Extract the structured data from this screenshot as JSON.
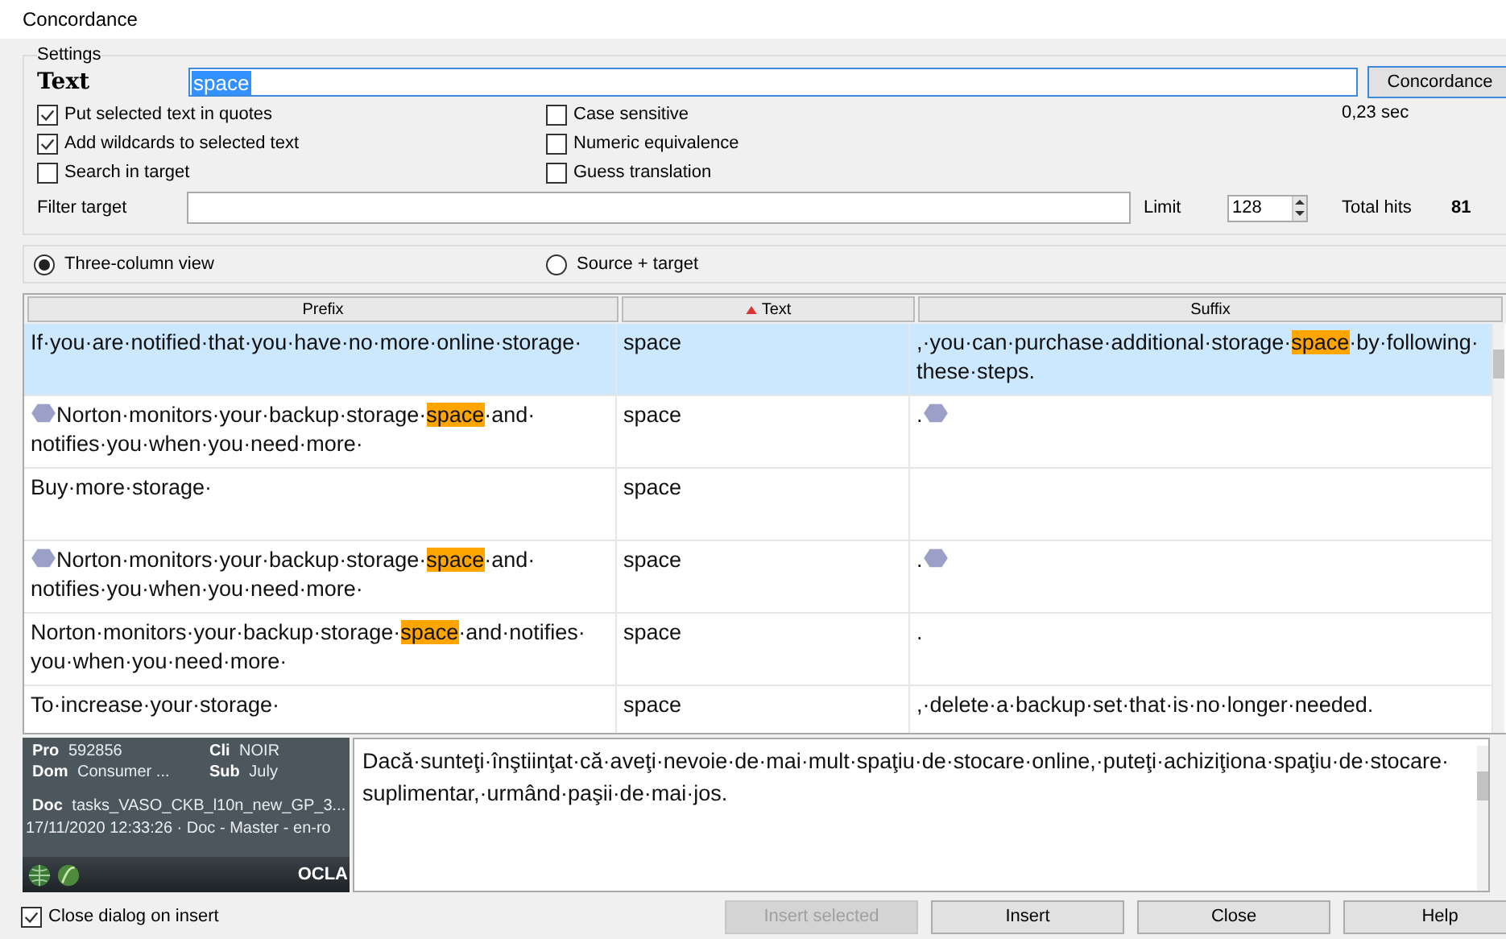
{
  "window": {
    "title": "Concordance"
  },
  "settings": {
    "legend": "Settings",
    "text_label": "Text",
    "text_value": "space",
    "concordance_button": "Concordance",
    "elapsed": "0,23 sec",
    "options": [
      {
        "label": "Put selected text in quotes",
        "checked": true
      },
      {
        "label": "Add wildcards to selected text",
        "checked": true
      },
      {
        "label": "Search in target",
        "checked": false
      },
      {
        "label": "Case sensitive",
        "checked": false
      },
      {
        "label": "Numeric equivalence",
        "checked": false
      },
      {
        "label": "Guess translation",
        "checked": false
      }
    ],
    "filter_label": "Filter target",
    "limit_label": "Limit",
    "limit_value": "128",
    "total_label": "Total hits",
    "total_value": "81"
  },
  "view_options": [
    {
      "label": "Three-column view",
      "selected": true
    },
    {
      "label": "Source + target",
      "selected": false
    }
  ],
  "table": {
    "columns": [
      {
        "label": "Prefix",
        "sorted": false
      },
      {
        "label": "Text",
        "sorted": true
      },
      {
        "label": "Suffix",
        "sorted": false
      }
    ],
    "rows": [
      {
        "selected": true,
        "prefix": [
          {
            "kind": "text",
            "text": "If·you·are·notified·that·you·have·no·more·online·storage·"
          }
        ],
        "text": "space",
        "suffix": [
          {
            "kind": "text",
            "text": ",·you·can·purchase·additional·storage·"
          },
          {
            "kind": "match",
            "text": "space"
          },
          {
            "kind": "text",
            "text": "·by·following·these·steps."
          }
        ]
      },
      {
        "selected": false,
        "prefix": [
          {
            "kind": "tag"
          },
          {
            "kind": "text",
            "text": "Norton·monitors·your·backup·storage·"
          },
          {
            "kind": "match",
            "text": "space"
          },
          {
            "kind": "text",
            "text": "·and·notifies·you·when·you·need·more·"
          }
        ],
        "text": "space",
        "suffix": [
          {
            "kind": "text",
            "text": "."
          },
          {
            "kind": "tag"
          }
        ]
      },
      {
        "selected": false,
        "prefix": [
          {
            "kind": "text",
            "text": "Buy·more·storage·"
          }
        ],
        "text": "space",
        "suffix": []
      },
      {
        "selected": false,
        "prefix": [
          {
            "kind": "tag"
          },
          {
            "kind": "text",
            "text": "Norton·monitors·your·backup·storage·"
          },
          {
            "kind": "match",
            "text": "space"
          },
          {
            "kind": "text",
            "text": "·and·notifies·you·when·you·need·more·"
          }
        ],
        "text": "space",
        "suffix": [
          {
            "kind": "text",
            "text": "."
          },
          {
            "kind": "tag"
          }
        ]
      },
      {
        "selected": false,
        "prefix": [
          {
            "kind": "text",
            "text": "Norton·monitors·your·backup·storage·"
          },
          {
            "kind": "match",
            "text": "space"
          },
          {
            "kind": "text",
            "text": "·and·notifies·you·when·you·need·more·"
          }
        ],
        "text": "space",
        "suffix": [
          {
            "kind": "text",
            "text": "."
          }
        ]
      },
      {
        "selected": false,
        "prefix": [
          {
            "kind": "text",
            "text": "To·increase·your·storage·"
          }
        ],
        "text": "space",
        "suffix": [
          {
            "kind": "text",
            "text": ",·delete·a·backup·set·that·is·no·longer·needed."
          }
        ]
      }
    ]
  },
  "info": {
    "fields": [
      {
        "label": "Pro",
        "value": "592856"
      },
      {
        "label": "Cli",
        "value": "NOIR"
      },
      {
        "label": "Dom",
        "value": "Consumer ..."
      },
      {
        "label": "Sub",
        "value": "July"
      },
      {
        "label": "Doc",
        "value": "tasks_VASO_CKB_l10n_new_GP_3..."
      }
    ],
    "timestamp": "17/11/2020 12:33:26 · Doc - Master - en-ro",
    "footer": "OCLA"
  },
  "target_text": "Dacă·sunteţi·înştiinţat·că·aveţi·nevoie·de·mai·mult·spaţiu·de·stocare·online,·puteţi·achiziţiona·spaţiu·de·stocare·suplimentar,·urmând·paşii·de·mai·jos.",
  "close_on_insert": {
    "label": "Close dialog on insert",
    "checked": true
  },
  "buttons": [
    {
      "label": "Insert selected",
      "disabled": true
    },
    {
      "label": "Insert",
      "disabled": false
    },
    {
      "label": "Close",
      "disabled": false
    },
    {
      "label": "Help",
      "disabled": false
    }
  ]
}
